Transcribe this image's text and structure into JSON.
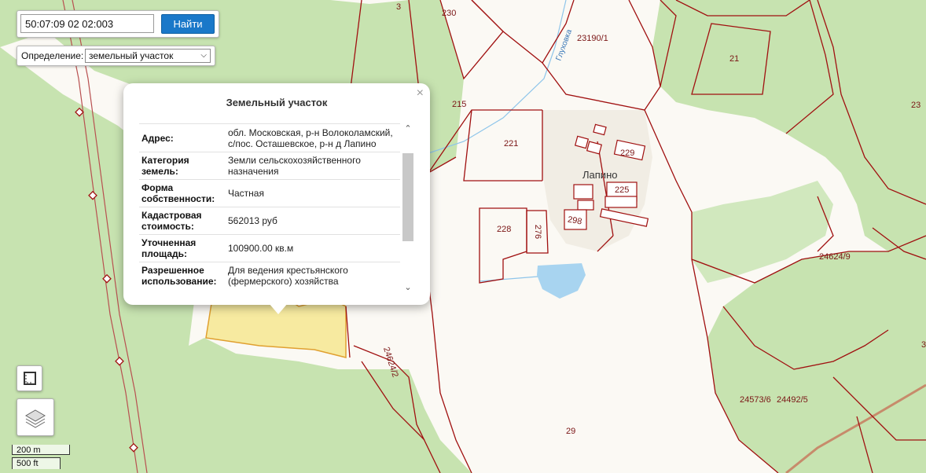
{
  "search": {
    "value": "50:07:09 02 02:003",
    "button_label": "Найти"
  },
  "definition": {
    "label": "Определение:",
    "selected": "земельный участок"
  },
  "popup": {
    "title": "Земельный участок",
    "close_label": "×",
    "rows": [
      {
        "key": "Адрес:",
        "value": "обл. Московская, р-н Волоколамский, с/пос. Осташевское, р-н д Лапино"
      },
      {
        "key": "Категория земель:",
        "value": "Земли сельскохозяйственного назначения"
      },
      {
        "key": "Форма собственности:",
        "value": "Частная"
      },
      {
        "key": "Кадастровая стоимость:",
        "value": "562013 руб"
      },
      {
        "key": "Уточненная площадь:",
        "value": "100900.00 кв.м"
      },
      {
        "key": "Разрешенное использование:",
        "value": "Для ведения крестьянского (фермерского) хозяйства"
      }
    ]
  },
  "map": {
    "place_name": "Лапино",
    "stream_name": "Глуховка",
    "parcel_labels": [
      "3",
      "230",
      "23190/1",
      "21",
      "215",
      "23",
      "221",
      "229",
      "225",
      "298",
      "228",
      "276",
      "24624/9",
      "24624/2",
      "24573/6",
      "24492/5",
      "29",
      "3"
    ],
    "colors": {
      "forest": "#c7e3b0",
      "field": "#fbf9f4",
      "boundary": "#a01010",
      "selected_parcel": "#f7eaa0",
      "water": "#a8d4f0"
    }
  },
  "controls": {
    "ruler_icon": "ruler-icon",
    "layers_icon": "layers-icon"
  },
  "scale": {
    "metric": "200 m",
    "imperial": "500 ft"
  }
}
